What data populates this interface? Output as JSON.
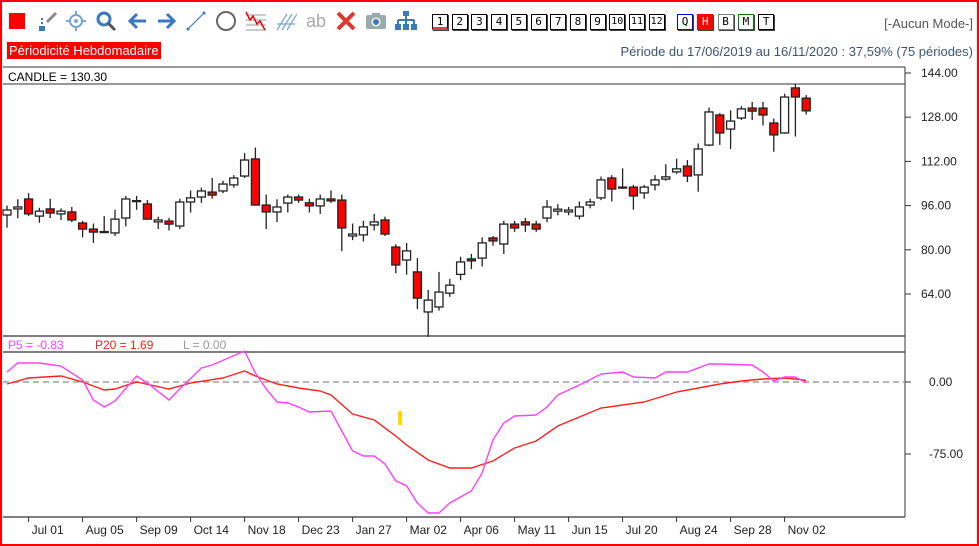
{
  "toolbar": {
    "icons": [
      "color-square-icon",
      "pencil-icon",
      "crosshair-icon",
      "zoom-icon",
      "arrow-left-icon",
      "arrow-right-icon",
      "line-icon",
      "circle-icon",
      "chart-tool-icon",
      "parallel-lines-icon",
      "text-icon",
      "delete-icon",
      "camera-icon",
      "hierarchy-icon"
    ],
    "text_tool_label": "ab",
    "number_buttons": [
      "1",
      "2",
      "3",
      "4",
      "5",
      "6",
      "7",
      "8",
      "9",
      "10",
      "11",
      "12"
    ],
    "period_buttons": [
      {
        "label": "Q",
        "color": "#0000ff"
      },
      {
        "label": "H",
        "color": "#ff0000"
      },
      {
        "label": "B",
        "color": "#808080"
      },
      {
        "label": "M",
        "color": "#008000"
      },
      {
        "label": "T",
        "color": "#000000"
      }
    ],
    "mode": "[-Aucun Mode-]"
  },
  "periodicity": "Périodicité Hebdomadaire",
  "period_summary": "Période du 17/06/2019 au 16/11/2020 : 37,59% (75 périodes)",
  "price_panel": {
    "label": "CANDLE = 130.30",
    "y_ticks": [
      "144.00",
      "128.00",
      "112.00",
      "96.00",
      "80.00",
      "64.00"
    ]
  },
  "osc_panel": {
    "p5_label": "P5 = -0.83",
    "p20_label": "P20 = 1.69",
    "l_label": "L = 0.00",
    "y_ticks": [
      "0.00",
      "-75.00"
    ]
  },
  "x_labels": [
    "Jul 01",
    "Aug 05",
    "Sep 09",
    "Oct 14",
    "Nov 18",
    "Dec 23",
    "Jan 27",
    "Mar 02",
    "Apr 06",
    "May 11",
    "Jun 15",
    "Jul 20",
    "Aug 24",
    "Sep 28",
    "Nov 02"
  ],
  "colors": {
    "up": "#ffffff",
    "down": "#ff0000",
    "p5": "#ff40ff",
    "p20": "#ff2020",
    "zero": "#a0a0a0",
    "accent": "#ff0000"
  },
  "chart_data": [
    {
      "type": "candlestick",
      "title": "CANDLE",
      "ylim": [
        44,
        146
      ],
      "y_ticks": [
        144,
        128,
        112,
        96,
        80,
        64
      ],
      "ohlc": [
        [
          92.6,
          96,
          88,
          94.4
        ],
        [
          94.8,
          98.3,
          91.4,
          95.5
        ],
        [
          98.4,
          100.5,
          92.2,
          93.0
        ],
        [
          92.2,
          95.2,
          89.8,
          94.0
        ],
        [
          94.8,
          98.5,
          91.5,
          93.3
        ],
        [
          93.0,
          95.0,
          90.8,
          94.0
        ],
        [
          93.7,
          95.5,
          90.0,
          90.8
        ],
        [
          89.7,
          90.5,
          84.5,
          87.5
        ],
        [
          87.5,
          89.5,
          82.5,
          86.4
        ],
        [
          86.4,
          92.2,
          86.2,
          86.6
        ],
        [
          86.1,
          94.5,
          85.0,
          91.1
        ],
        [
          91.5,
          99.5,
          88.5,
          98.4
        ],
        [
          97.6,
          99.5,
          94.5,
          97.8
        ],
        [
          96.6,
          98.0,
          91.0,
          91.1
        ],
        [
          90.1,
          92.0,
          87.5,
          90.8
        ],
        [
          90.4,
          91.5,
          87.0,
          89.3
        ],
        [
          88.6,
          98.5,
          87.5,
          97.3
        ],
        [
          97.3,
          101.5,
          93.5,
          98.8
        ],
        [
          99.1,
          102.5,
          97.0,
          101.3
        ],
        [
          100.9,
          106.0,
          98.5,
          99.8
        ],
        [
          101.3,
          105.0,
          100.5,
          103.8
        ],
        [
          103.5,
          107.0,
          102.5,
          106.0
        ],
        [
          106.7,
          115.0,
          106.0,
          112.5
        ],
        [
          112.9,
          117.0,
          96.0,
          96.2
        ],
        [
          96.2,
          100.0,
          87.5,
          93.7
        ],
        [
          93.7,
          98.3,
          90.0,
          95.5
        ],
        [
          96.9,
          100.0,
          93.5,
          99.1
        ],
        [
          99.1,
          100.0,
          97.0,
          98.0
        ],
        [
          97.0,
          98.5,
          93.5,
          95.9
        ],
        [
          95.9,
          100.0,
          93.0,
          98.4
        ],
        [
          98.4,
          101.5,
          97.0,
          97.7
        ],
        [
          98.0,
          100.0,
          79.5,
          87.9
        ],
        [
          85.0,
          89.5,
          83.5,
          85.7
        ],
        [
          85.4,
          90.5,
          83.0,
          88.3
        ],
        [
          89.0,
          93.0,
          87.0,
          90.1
        ],
        [
          90.8,
          92.0,
          85.0,
          85.7
        ],
        [
          81.0,
          82.0,
          71.5,
          74.5
        ],
        [
          76.3,
          82.5,
          71.0,
          79.6
        ],
        [
          72.0,
          77.0,
          58.5,
          62.5
        ],
        [
          57.5,
          65.5,
          48.5,
          61.8
        ],
        [
          59.3,
          72.0,
          58.0,
          64.7
        ],
        [
          64.3,
          69.5,
          63.0,
          67.2
        ],
        [
          71.1,
          77.5,
          69.0,
          75.6
        ],
        [
          76.7,
          78.5,
          73.0,
          76.0
        ],
        [
          77.0,
          84.5,
          74.0,
          82.5
        ],
        [
          84.3,
          85.0,
          81.5,
          83.2
        ],
        [
          82.1,
          90.5,
          78.5,
          89.3
        ],
        [
          89.3,
          90.5,
          86.5,
          87.9
        ],
        [
          90.1,
          91.5,
          86.5,
          89.0
        ],
        [
          89.3,
          90.5,
          86.5,
          87.5
        ],
        [
          91.5,
          98.0,
          90.0,
          95.5
        ],
        [
          94.0,
          96.5,
          92.5,
          94.7
        ],
        [
          93.7,
          95.5,
          92.5,
          94.4
        ],
        [
          92.2,
          97.5,
          91.0,
          95.5
        ],
        [
          96.2,
          98.5,
          95.0,
          97.3
        ],
        [
          98.8,
          106.5,
          98.0,
          105.3
        ],
        [
          106.0,
          107.0,
          97.5,
          102.0
        ],
        [
          102.4,
          109.5,
          102.0,
          102.7
        ],
        [
          102.7,
          103.5,
          94.5,
          99.5
        ],
        [
          100.6,
          103.5,
          98.5,
          102.7
        ],
        [
          103.5,
          107.0,
          101.5,
          105.3
        ],
        [
          105.6,
          111.0,
          105.0,
          106.4
        ],
        [
          108.2,
          113.0,
          107.5,
          109.3
        ],
        [
          110.3,
          112.5,
          104.5,
          106.7
        ],
        [
          107.1,
          118.5,
          101.0,
          116.5
        ],
        [
          117.9,
          131.5,
          117.5,
          129.9
        ],
        [
          128.8,
          129.5,
          118.0,
          122.3
        ],
        [
          123.7,
          130.5,
          116.5,
          126.6
        ],
        [
          127.7,
          132.0,
          127.0,
          131.0
        ],
        [
          131.3,
          133.5,
          127.0,
          130.2
        ],
        [
          131.3,
          133.5,
          125.0,
          128.8
        ],
        [
          125.9,
          127.5,
          115.5,
          121.6
        ],
        [
          122.3,
          136.5,
          122.0,
          135.3
        ],
        [
          138.6,
          140.0,
          121.0,
          135.3
        ],
        [
          134.9,
          136.0,
          129.0,
          130.3
        ]
      ]
    },
    {
      "type": "line",
      "title": "Oscillator",
      "ylim": [
        -140,
        31
      ],
      "y_ticks": [
        0,
        -75
      ],
      "x_tick_weeks": [
        2,
        7,
        12,
        17,
        22,
        27,
        32,
        37,
        42,
        47,
        52,
        57,
        62,
        67,
        72
      ],
      "series": [
        {
          "name": "P5",
          "points": [
            [
              0,
              10.4
            ],
            [
              1,
              19.8
            ],
            [
              3,
              19.8
            ],
            [
              5,
              16.7
            ],
            [
              7,
              2.1
            ],
            [
              8,
              -18.8
            ],
            [
              9,
              -26
            ],
            [
              10,
              -19.8
            ],
            [
              12,
              6.3
            ],
            [
              13,
              -1
            ],
            [
              15,
              -18.8
            ],
            [
              16,
              -7.3
            ],
            [
              18,
              14.6
            ],
            [
              19,
              17.7
            ],
            [
              22,
              32.3
            ],
            [
              23,
              9.4
            ],
            [
              24,
              -7.3
            ],
            [
              25,
              -20.8
            ],
            [
              26,
              -21.9
            ],
            [
              27,
              -26
            ],
            [
              28,
              -31.3
            ],
            [
              30,
              -30.2
            ],
            [
              32,
              -71.9
            ],
            [
              33,
              -77.1
            ],
            [
              34,
              -77.1
            ],
            [
              35,
              -85.4
            ],
            [
              36,
              -103
            ],
            [
              37,
              -108
            ],
            [
              38,
              -126
            ],
            [
              39,
              -136.5
            ],
            [
              40,
              -136.5
            ],
            [
              41,
              -126
            ],
            [
              43,
              -113.5
            ],
            [
              44,
              -94.8
            ],
            [
              45,
              -60.4
            ],
            [
              46,
              -42.7
            ],
            [
              47,
              -35.4
            ],
            [
              49,
              -34.4
            ],
            [
              50,
              -26
            ],
            [
              51,
              -13.5
            ],
            [
              53,
              -3.1
            ],
            [
              55,
              8.3
            ],
            [
              57,
              10.4
            ],
            [
              58,
              5.2
            ],
            [
              60,
              4.2
            ],
            [
              61,
              10.4
            ],
            [
              63,
              10.4
            ],
            [
              65,
              18.8
            ],
            [
              66,
              18.8
            ],
            [
              69,
              17.7
            ],
            [
              70,
              10.4
            ],
            [
              71,
              1
            ],
            [
              72,
              5.2
            ],
            [
              73,
              5.2
            ],
            [
              74,
              -0.83
            ]
          ]
        },
        {
          "name": "P20",
          "points": [
            [
              0,
              -2.1
            ],
            [
              2,
              4.2
            ],
            [
              5,
              6.3
            ],
            [
              7,
              0
            ],
            [
              9,
              -8.3
            ],
            [
              10,
              -7.3
            ],
            [
              12,
              0
            ],
            [
              15,
              -7.3
            ],
            [
              17,
              -1
            ],
            [
              20,
              4.2
            ],
            [
              22,
              11.5
            ],
            [
              23,
              6.3
            ],
            [
              25,
              -2.1
            ],
            [
              27,
              -6.3
            ],
            [
              29,
              -9.4
            ],
            [
              30,
              -13.5
            ],
            [
              32,
              -33.3
            ],
            [
              34,
              -39.6
            ],
            [
              36,
              -56.3
            ],
            [
              37,
              -65.6
            ],
            [
              39,
              -81.3
            ],
            [
              41,
              -89.6
            ],
            [
              43,
              -89.6
            ],
            [
              45,
              -82.3
            ],
            [
              47,
              -68.8
            ],
            [
              49,
              -61.5
            ],
            [
              51,
              -45.8
            ],
            [
              55,
              -27.1
            ],
            [
              59,
              -20.8
            ],
            [
              62,
              -10.4
            ],
            [
              66,
              -2.1
            ],
            [
              68,
              1
            ],
            [
              70,
              3.1
            ],
            [
              72,
              4.2
            ],
            [
              73,
              3.1
            ],
            [
              74,
              1.69
            ]
          ]
        },
        {
          "name": "L",
          "value": 0
        }
      ]
    }
  ]
}
